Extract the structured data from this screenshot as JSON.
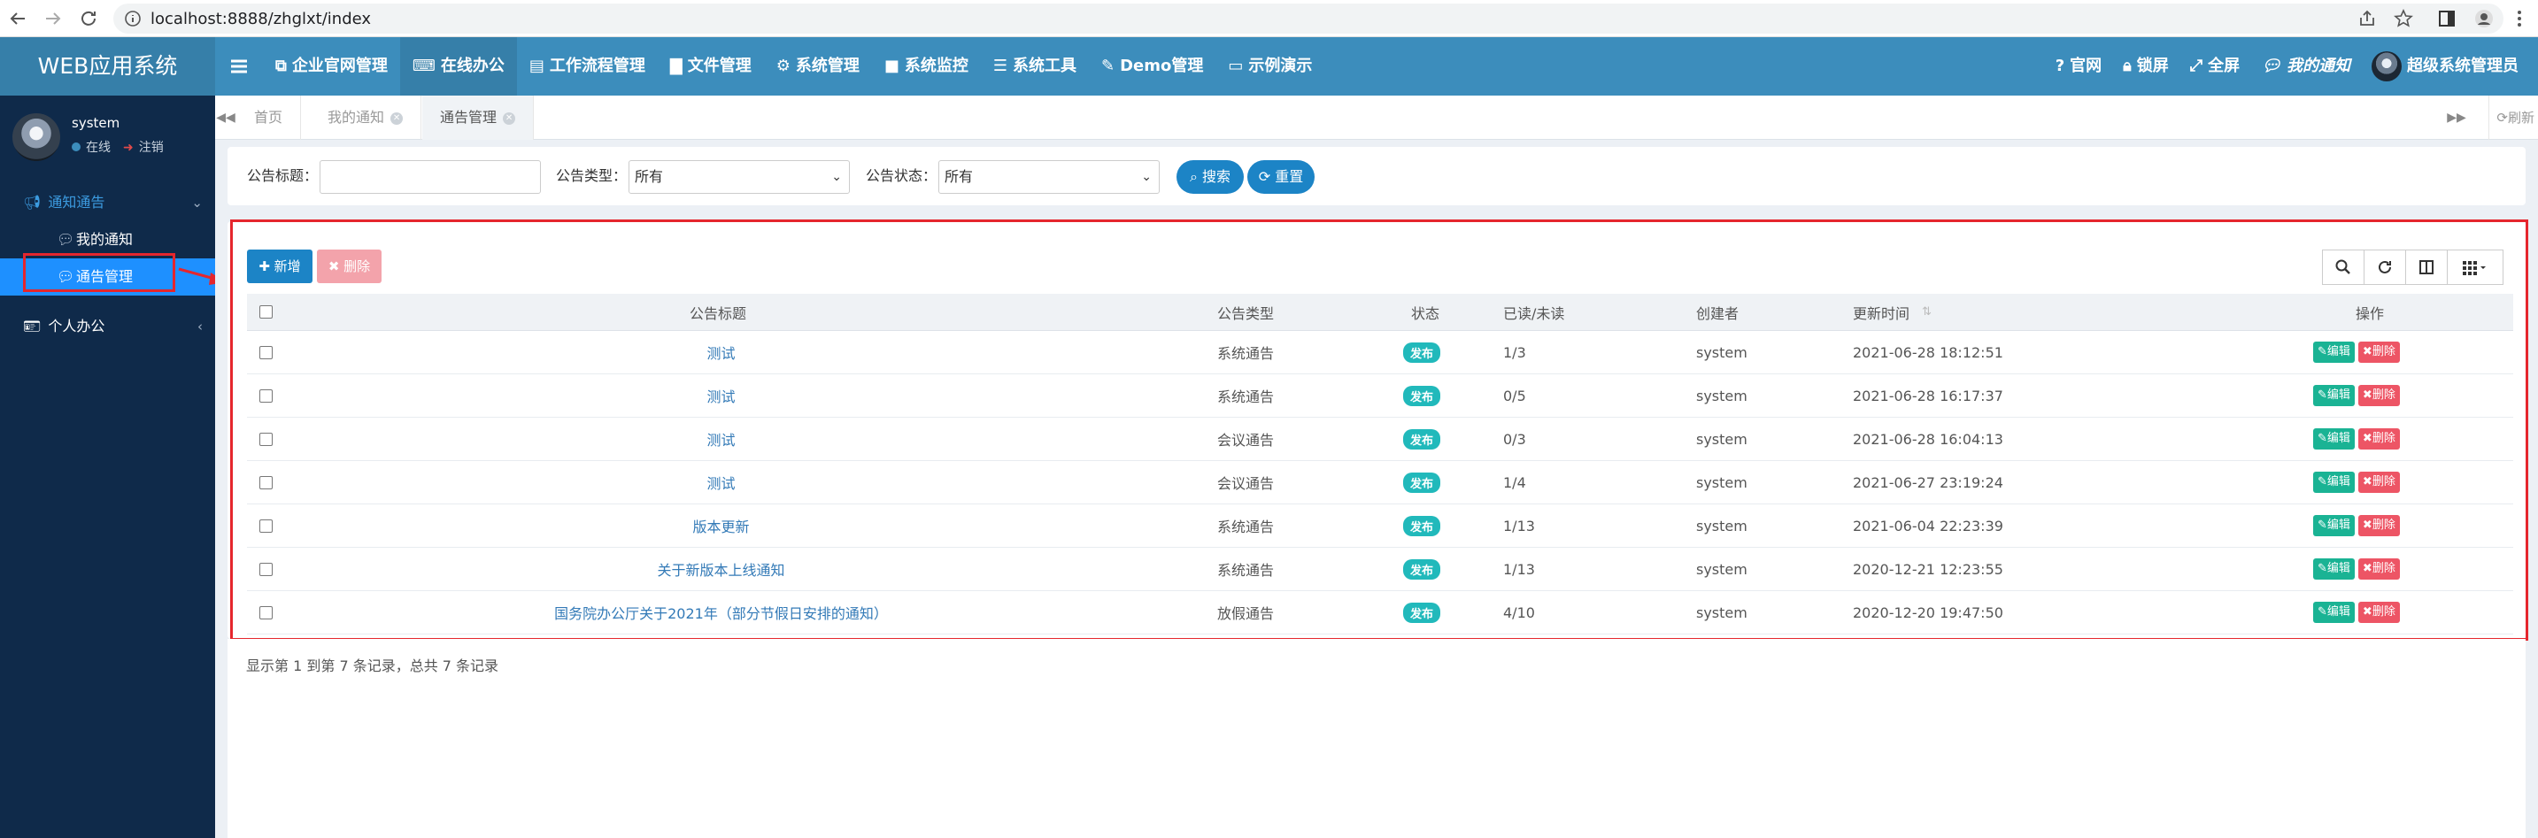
{
  "browser": {
    "url": "localhost:8888/zhglxt/index"
  },
  "header": {
    "logo": "WEB应用系统",
    "nav": [
      {
        "label": "企业官网管理",
        "icon": "copy-icon"
      },
      {
        "label": "在线办公",
        "icon": "keyboard-icon"
      },
      {
        "label": "工作流程管理",
        "icon": "list-alt-icon"
      },
      {
        "label": "文件管理",
        "icon": "folder-icon"
      },
      {
        "label": "系统管理",
        "icon": "cog-icon"
      },
      {
        "label": "系统监控",
        "icon": "video-icon"
      },
      {
        "label": "系统工具",
        "icon": "bars-icon"
      },
      {
        "label": "Demo管理",
        "icon": "edit-icon"
      },
      {
        "label": "示例演示",
        "icon": "desktop-icon"
      }
    ],
    "right": {
      "official": "官网",
      "lock": "锁屏",
      "fullscreen": "全屏",
      "notice": "我的通知",
      "user": "超级系统管理员"
    }
  },
  "sidebar": {
    "user": {
      "name": "system",
      "online": "在线",
      "logout": "注销"
    },
    "menu": {
      "notice_group": "通知通告",
      "my_notice": "我的通知",
      "notice_manage": "通告管理",
      "personal": "个人办公"
    }
  },
  "tabs": {
    "home": "首页",
    "my_notice": "我的通知",
    "notice_manage": "通告管理",
    "refresh": "刷新"
  },
  "search": {
    "title_label": "公告标题：",
    "type_label": "公告类型：",
    "type_value": "所有",
    "status_label": "公告状态：",
    "status_value": "所有",
    "search_btn": "搜索",
    "reset_btn": "重置"
  },
  "toolbar": {
    "add": "新增",
    "delete": "删除"
  },
  "table": {
    "headers": {
      "title": "公告标题",
      "type": "公告类型",
      "status": "状态",
      "read": "已读/未读",
      "creator": "创建者",
      "updated": "更新时间",
      "actions": "操作"
    },
    "edit_label": "编辑",
    "delete_label": "删除",
    "rows": [
      {
        "title": "测试",
        "type": "系统通告",
        "status": "发布",
        "read": "1/3",
        "creator": "system",
        "updated": "2021-06-28 18:12:51"
      },
      {
        "title": "测试",
        "type": "系统通告",
        "status": "发布",
        "read": "0/5",
        "creator": "system",
        "updated": "2021-06-28 16:17:37"
      },
      {
        "title": "测试",
        "type": "会议通告",
        "status": "发布",
        "read": "0/3",
        "creator": "system",
        "updated": "2021-06-28 16:04:13"
      },
      {
        "title": "测试",
        "type": "会议通告",
        "status": "发布",
        "read": "1/4",
        "creator": "system",
        "updated": "2021-06-27 23:19:24"
      },
      {
        "title": "版本更新",
        "type": "系统通告",
        "status": "发布",
        "read": "1/13",
        "creator": "system",
        "updated": "2021-06-04 22:23:39"
      },
      {
        "title": "关于新版本上线通知",
        "type": "系统通告",
        "status": "发布",
        "read": "1/13",
        "creator": "system",
        "updated": "2020-12-21 12:23:55"
      },
      {
        "title": "国务院办公厅关于2021年（部分节假日安排的通知）",
        "type": "放假通告",
        "status": "发布",
        "read": "4/10",
        "creator": "system",
        "updated": "2020-12-20 19:47:50"
      }
    ]
  },
  "pagination": {
    "summary": "显示第 1 到第 7 条记录，总共 7 条记录"
  },
  "colors": {
    "topnav": "#3c8dbc",
    "sidebar": "#0f2a4a",
    "active": "#1e90ff",
    "highlight": "#e5262d",
    "badge": "#21b9bb"
  }
}
